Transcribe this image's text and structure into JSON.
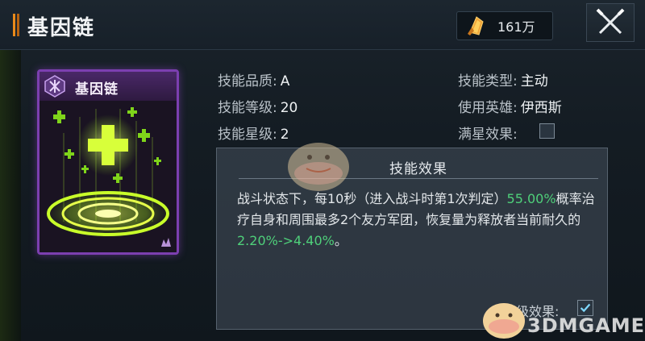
{
  "header": {
    "title": "基因链",
    "currency_amount": "161万",
    "currency_icon": "gold-crystal-icon",
    "close_icon": "close-icon"
  },
  "card": {
    "title": "基因链",
    "icon": "gene-chain-skill-icon"
  },
  "stats": {
    "quality": {
      "label": "技能品质:",
      "value": "A"
    },
    "level": {
      "label": "技能等级:",
      "value": "20"
    },
    "star": {
      "label": "技能星级:",
      "value": "2"
    },
    "type": {
      "label": "技能类型:",
      "value": "主动"
    },
    "hero": {
      "label": "使用英雄:",
      "value": "伊西斯"
    },
    "max_star": {
      "label": "满星效果:",
      "checked": false
    }
  },
  "effect": {
    "title": "技能效果",
    "text_part1": "战斗状态下，每10秒（进入战斗时第1次判定）",
    "highlight1": "55.00%",
    "text_part2": "概率治疗自身和周围最多2个友方军团，恢复量为释放者当前耐久的",
    "highlight2": "2.20%->4.40%",
    "text_part3": "。",
    "awaken_label": "觉级效果:",
    "awaken_checked": true
  },
  "watermark": "3DMGAME",
  "colors": {
    "accent_orange": "#e98a1b",
    "card_border": "#7c3fb0",
    "highlight_green": "#4fd07a",
    "glow_green": "#b6ff2a"
  }
}
